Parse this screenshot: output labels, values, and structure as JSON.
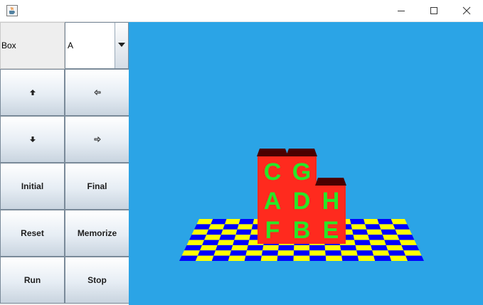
{
  "window": {
    "icon": "java-cup-icon",
    "controls": [
      "minimize-icon",
      "maximize-icon",
      "close-icon"
    ]
  },
  "panel": {
    "object_label": "Box",
    "object_select": {
      "value": "A"
    },
    "buttons": {
      "up": {
        "icon": "arrow-up-icon"
      },
      "left": {
        "icon": "arrow-left-icon"
      },
      "down": {
        "icon": "arrow-down-icon"
      },
      "right": {
        "icon": "arrow-right-icon"
      },
      "initial": "Initial",
      "final": "Final",
      "reset": "Reset",
      "memorize": "Memorize",
      "run": "Run",
      "stop": "Stop"
    }
  },
  "scene": {
    "colors": {
      "background": "#2ba4e6",
      "checker_a": "#ffff00",
      "checker_b": "#0000ff",
      "box_front": "#ff2a1e",
      "box_top": "#4a0000",
      "letter": "#27e827"
    },
    "stacks": [
      [
        "F",
        "A",
        "C"
      ],
      [
        "B",
        "D",
        "G"
      ],
      [
        "E",
        "H"
      ]
    ]
  }
}
